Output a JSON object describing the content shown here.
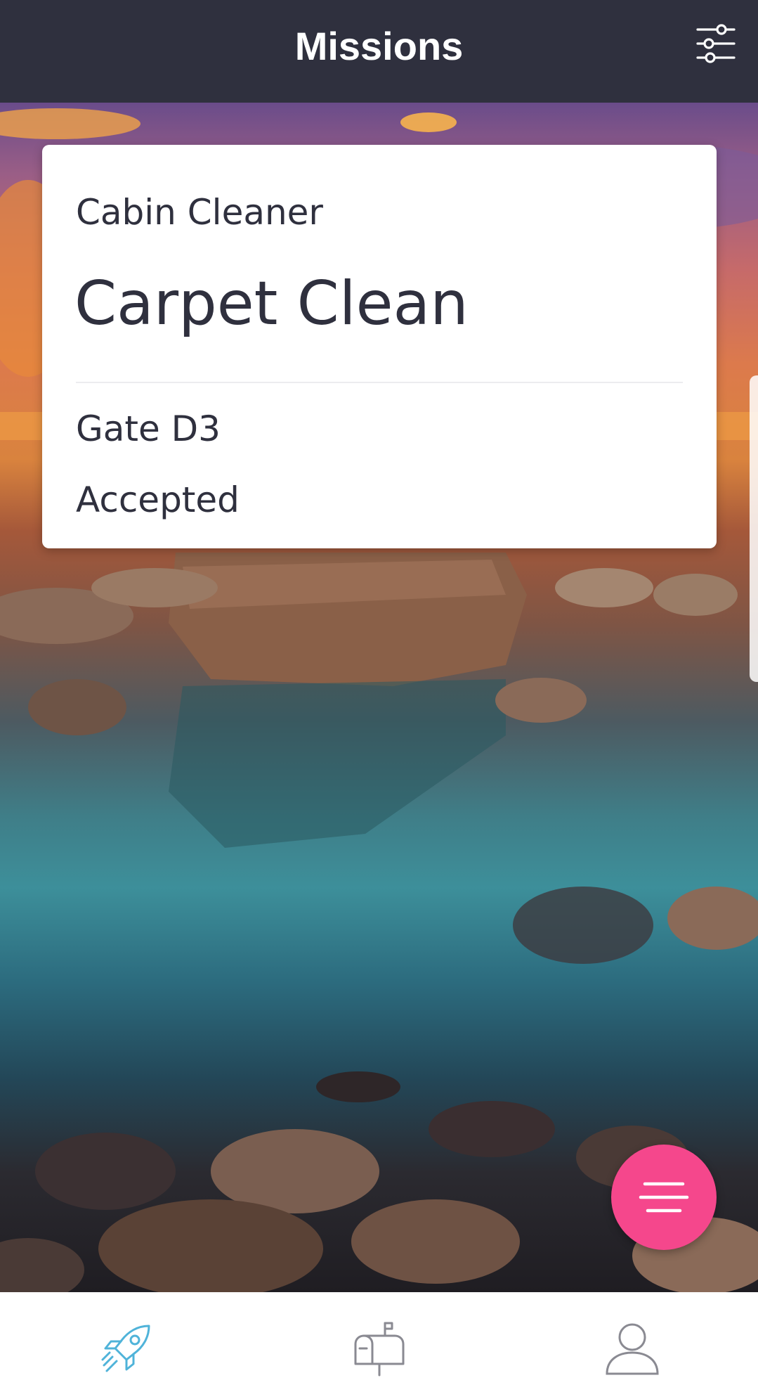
{
  "header": {
    "title": "Missions",
    "filter_icon": "sliders-icon"
  },
  "mission_card": {
    "role": "Cabin Cleaner",
    "task": "Carpet Clean",
    "location": "Gate D3",
    "status": "Accepted"
  },
  "fab": {
    "icon": "menu-lines-icon",
    "color": "#f5478c"
  },
  "bottom_nav": {
    "items": [
      {
        "icon": "rocket-icon",
        "active": true
      },
      {
        "icon": "mailbox-icon",
        "active": false
      },
      {
        "icon": "user-icon",
        "active": false
      }
    ],
    "active_color": "#4fb3d9",
    "inactive_color": "#8a8a92"
  },
  "colors": {
    "header_bg": "#2f303e",
    "text_dark": "#2f303e",
    "accent_pink": "#f5478c"
  }
}
